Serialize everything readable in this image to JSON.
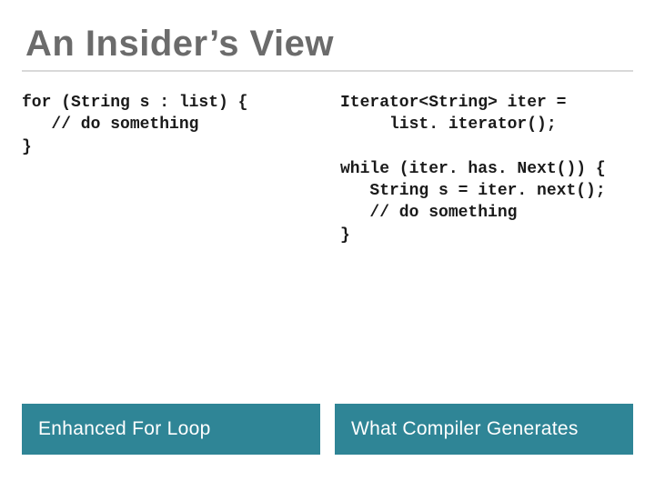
{
  "title": "An Insider’s View",
  "left": {
    "code": "for (String s : list) {\n   // do something\n}",
    "label": "Enhanced For Loop"
  },
  "right": {
    "code": "Iterator<String> iter =\n     list. iterator();\n\nwhile (iter. has. Next()) {\n   String s = iter. next();\n   // do something\n}",
    "label": "What Compiler Generates"
  },
  "colors": {
    "accent": "#2f8596",
    "title": "#6b6b6b"
  }
}
